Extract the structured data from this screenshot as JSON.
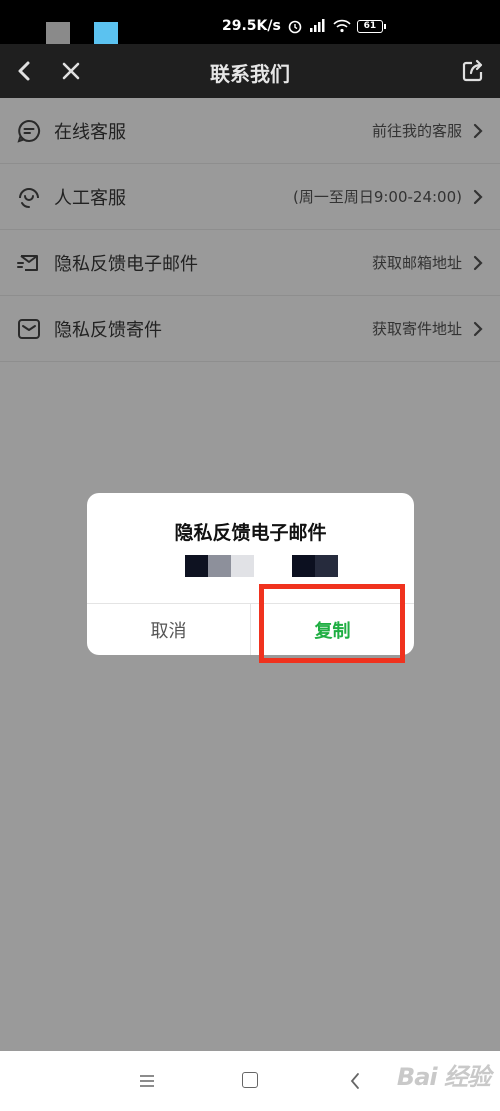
{
  "status_bar": {
    "speed": "29.5K/s",
    "battery": "61"
  },
  "nav": {
    "title": "联系我们"
  },
  "list": [
    {
      "label": "在线客服",
      "value": "前往我的客服"
    },
    {
      "label": "人工客服",
      "value": "(周一至周日9:00-24:00)"
    },
    {
      "label": "隐私反馈电子邮件",
      "value": "获取邮箱地址"
    },
    {
      "label": "隐私反馈寄件",
      "value": "获取寄件地址"
    }
  ],
  "dialog": {
    "title": "隐私反馈电子邮件",
    "cancel_label": "取消",
    "copy_label": "复制"
  },
  "colors": {
    "accent_green": "#1fae42",
    "highlight_red": "#f0321e",
    "overlay_gray": "#9a9a9a"
  },
  "icons": [
    "back-icon",
    "close-icon",
    "share-icon",
    "chat-icon",
    "agent-icon",
    "email-list-icon",
    "mail-icon",
    "chevron-right-icon",
    "menu-icon",
    "home-icon",
    "nav-back-icon"
  ],
  "watermark": "Bai 经验"
}
